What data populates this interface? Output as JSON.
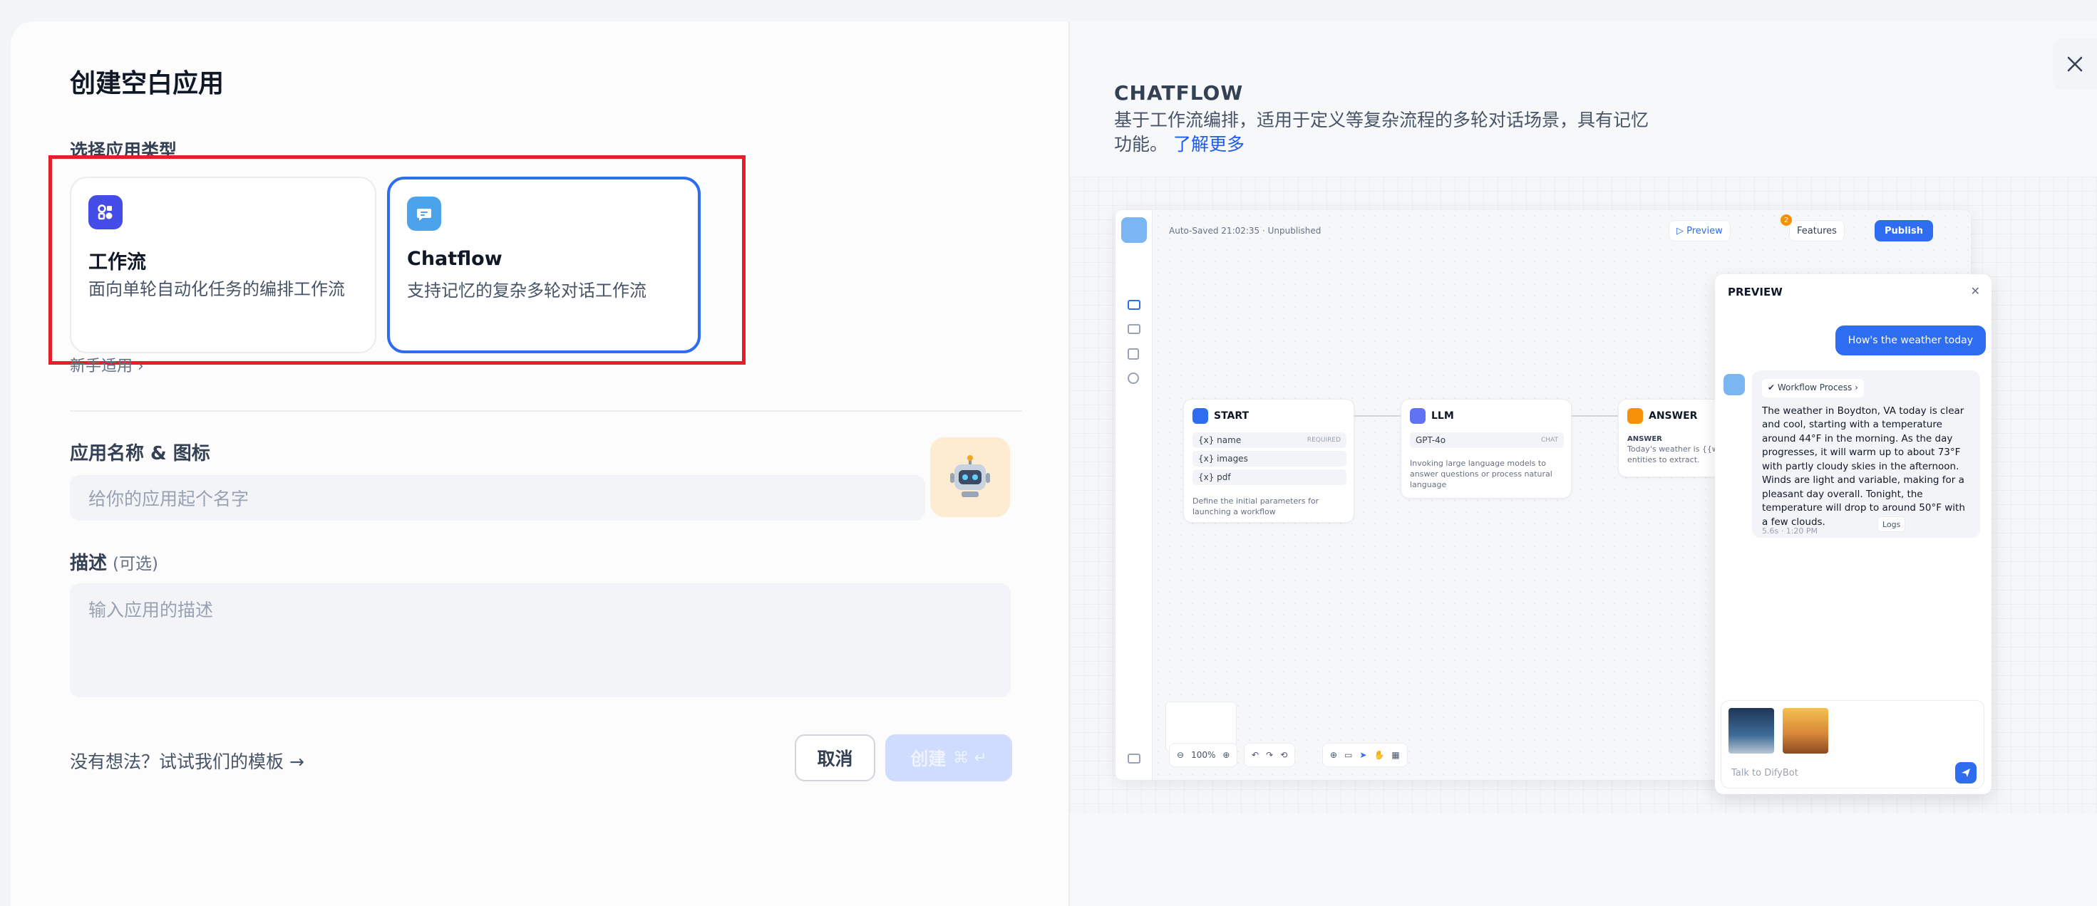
{
  "left": {
    "title": "创建空白应用",
    "section_type_label": "选择应用类型",
    "types": [
      {
        "title": "工作流",
        "desc": "面向单轮自动化任务的编排工作流",
        "icon": "workflow-icon",
        "color": "#444ce7",
        "selected": false
      },
      {
        "title": "Chatflow",
        "desc": "支持记忆的复杂多轮对话工作流",
        "icon": "chat-icon",
        "color": "#4ba3ec",
        "selected": true
      }
    ],
    "guide_label": "新手适用 ›",
    "name_label": "应用名称 & 图标",
    "name_placeholder": "给你的应用起个名字",
    "desc_label": "描述",
    "desc_optional": "(可选)",
    "desc_placeholder": "输入应用的描述",
    "template_link": "没有想法？试试我们的模板 →",
    "cancel_label": "取消",
    "create_label": "创建",
    "create_shortcut": "⌘ ↵"
  },
  "right": {
    "title": "CHATFLOW",
    "desc": "基于工作流编排，适用于定义等复杂流程的多轮对话场景，具有记忆功能。",
    "learn_more": "了解更多",
    "preview": {
      "autosave": "Auto-Saved 21:02:35 · Unpublished",
      "preview_btn": "▷ Preview",
      "features_btn": "Features",
      "publish_btn": "Publish",
      "badge": "2",
      "zoom": "100%",
      "nodes": {
        "start": {
          "title": "START",
          "rows": [
            "{x} name",
            "{x} images",
            "{x} pdf"
          ],
          "required": "REQUIRED",
          "note": "Define the initial parameters for launching a workflow"
        },
        "llm": {
          "title": "LLM",
          "model": "GPT-4o",
          "mode": "CHAT",
          "note": "Invoking large language models to answer questions or process natural language"
        },
        "answer": {
          "title": "ANSWER",
          "label": "ANSWER",
          "note": "Today's weather is {{w entities to extract."
        }
      },
      "chat": {
        "header": "PREVIEW",
        "user_msg": "How's the weather today",
        "workflow_pill": "✔ Workflow Process ›",
        "bot_msg": "The weather in Boydton, VA today is clear and cool, starting with a temperature around 44°F in the morning. As the day progresses, it will warm up to about 73°F with partly cloudy skies in the afternoon. Winds are light and variable, making for a pleasant day overall. Tonight, the temperature will drop to around 50°F with a few clouds.",
        "meta": "5.6s · 1:20 PM",
        "logs": "Logs",
        "input_placeholder": "Talk to DifyBot"
      }
    }
  },
  "colors": {
    "accent": "#2e6cf0",
    "highlight": "#e41f2a"
  }
}
